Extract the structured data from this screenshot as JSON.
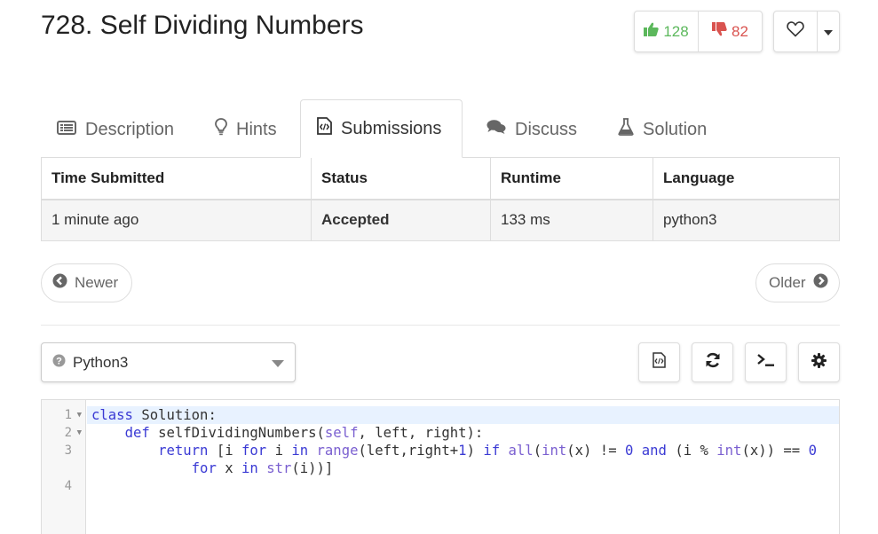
{
  "problem": {
    "title": "728. Self Dividing Numbers",
    "likes": "128",
    "dislikes": "82"
  },
  "colors": {
    "like": "#5cb85c",
    "dislike": "#d9534f",
    "accepted": "#3c9d3f",
    "keyword": "#3a3ad4",
    "active_line": "#e8f2ff"
  },
  "tabs": [
    {
      "label": "Description",
      "icon": "list-alt-icon"
    },
    {
      "label": "Hints",
      "icon": "lightbulb-icon"
    },
    {
      "label": "Submissions",
      "icon": "code-file-icon"
    },
    {
      "label": "Discuss",
      "icon": "comments-icon"
    },
    {
      "label": "Solution",
      "icon": "flask-icon"
    }
  ],
  "active_tab": "Submissions",
  "submissions": {
    "headers": [
      "Time Submitted",
      "Status",
      "Runtime",
      "Language"
    ],
    "rows": [
      [
        "1 minute ago",
        "Accepted",
        "133 ms",
        "python3"
      ]
    ]
  },
  "pager": {
    "newer": "Newer",
    "older": "Older"
  },
  "editor": {
    "language": "Python3",
    "toolbar_icons": [
      "code-file-icon",
      "refresh-icon",
      "terminal-icon",
      "gear-icon"
    ],
    "line_numbers": [
      "1",
      "2",
      "3",
      "4"
    ],
    "code_lines": [
      "class Solution:",
      "    def selfDividingNumbers(self, left, right):",
      "        return [i for i in range(left,right+1) if all(int(x) != 0 and (i % int(x)) == 0",
      "            for x in str(i))]"
    ]
  }
}
